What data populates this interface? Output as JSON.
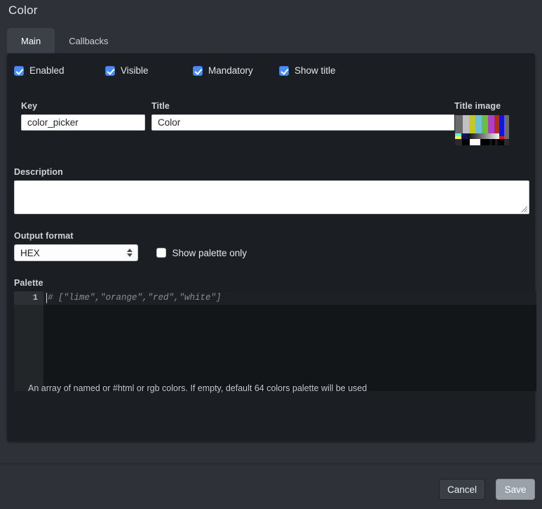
{
  "window": {
    "title": "Color"
  },
  "tabs": [
    {
      "label": "Main",
      "active": true
    },
    {
      "label": "Callbacks",
      "active": false
    }
  ],
  "checkboxes": [
    {
      "label": "Enabled",
      "checked": true
    },
    {
      "label": "Visible",
      "checked": true
    },
    {
      "label": "Mandatory",
      "checked": true
    },
    {
      "label": "Show title",
      "checked": true
    }
  ],
  "fields": {
    "key": {
      "label": "Key",
      "value": "color_picker",
      "placeholder": ""
    },
    "title": {
      "label": "Title",
      "value": "Color",
      "placeholder": ""
    },
    "title_image": {
      "label": "Title image",
      "icon": "tv-test-pattern-image"
    },
    "description": {
      "label": "Description",
      "value": "",
      "placeholder": ""
    },
    "output_format": {
      "label": "Output format",
      "value": "HEX",
      "options": [
        "HEX"
      ]
    },
    "show_palette_only": {
      "label": "Show palette only",
      "checked": false
    },
    "palette": {
      "label": "Palette",
      "line_number": "1",
      "value": "",
      "placeholder": "# [\"lime\",\"orange\",\"red\",\"white\"]",
      "help": "An array of named or #html or rgb colors. If empty, default 64 colors palette will be used"
    }
  },
  "footer": {
    "cancel_label": "Cancel",
    "save_label": "Save"
  },
  "colors": {
    "page_background": "#2e3238",
    "panel_background": "#1b1e23",
    "accent_checkbox": "#4a8cf7",
    "tab_active": "#3c4148",
    "editor_background": "#131619",
    "save_button": "#9ba1a8"
  },
  "title_image_bars": {
    "top_row": [
      "#6b6b6b",
      "#c0c0c0",
      "#c6c821",
      "#6cc2d0",
      "#6abf3f",
      "#b13fbf",
      "#b22f10",
      "#1414d8",
      "#6b6b6b"
    ],
    "mid_row": [
      "#1414d8",
      "#101010",
      "#b13fbf",
      "#101010",
      "#6cc2d0",
      "#101010",
      "#c0c0c0",
      "#6b6b6b"
    ],
    "bottom_row": [
      "#101010",
      "#000000",
      "#ffffff",
      "#000000",
      "#101010",
      "#1a1a1a",
      "#101010"
    ]
  }
}
